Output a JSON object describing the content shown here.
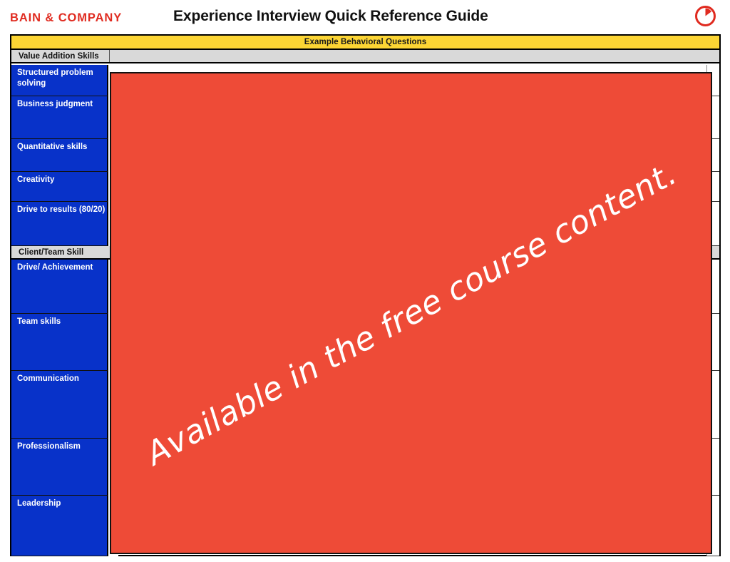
{
  "header": {
    "brand_wordmark": "BAIN & COMPANY",
    "title": "Experience Interview Quick Reference Guide",
    "brand_mark_icon": "bain-circle-logo-icon",
    "brand_color": "#E02B20"
  },
  "table": {
    "banner": {
      "label": "Example Behavioral Questions",
      "background": "#FCD534"
    },
    "sections": [
      {
        "label": "Value Addition Skills",
        "background": "#D9D9D9",
        "clipped": false,
        "rows": [
          {
            "label": "Structured problem solving"
          },
          {
            "label": "Business judgment"
          },
          {
            "label": "Quantitative skills"
          },
          {
            "label": "Creativity"
          },
          {
            "label": "Drive to results (80/20)"
          }
        ]
      },
      {
        "label": "Client/Team Skill",
        "background": "#D9D9D9",
        "clipped": true,
        "rows": [
          {
            "label": "Drive/ Achievement"
          },
          {
            "label": "Team skills"
          },
          {
            "label": "Communication"
          },
          {
            "label": "Professionalism"
          },
          {
            "label": "Leadership"
          }
        ]
      }
    ],
    "skill_cell_color": "#0832C9",
    "skill_text_color": "#FFFFFF"
  },
  "redaction": {
    "message": "Available in the free course content.",
    "color": "#EE4B37",
    "text_color": "#FFFFFF"
  }
}
